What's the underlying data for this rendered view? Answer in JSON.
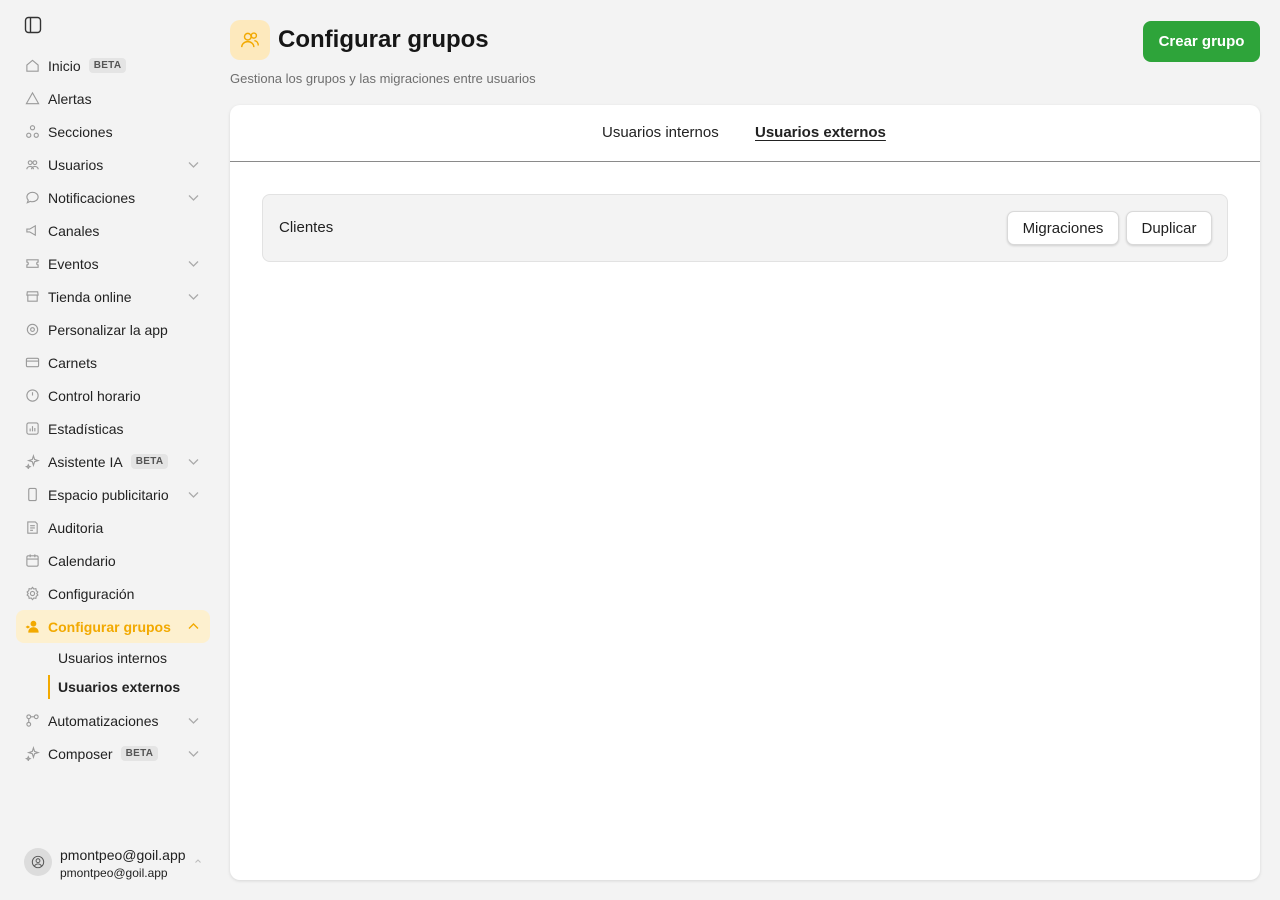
{
  "sidebar": {
    "items": [
      {
        "label": "Inicio",
        "badge": "BETA",
        "icon": "home-icon",
        "expandable": false
      },
      {
        "label": "Alertas",
        "badge": "",
        "icon": "alert-icon",
        "expandable": false
      },
      {
        "label": "Secciones",
        "badge": "",
        "icon": "sections-icon",
        "expandable": false
      },
      {
        "label": "Usuarios",
        "badge": "",
        "icon": "users-icon",
        "expandable": true
      },
      {
        "label": "Notificaciones",
        "badge": "",
        "icon": "chat-icon",
        "expandable": true
      },
      {
        "label": "Canales",
        "badge": "",
        "icon": "megaphone-icon",
        "expandable": false
      },
      {
        "label": "Eventos",
        "badge": "",
        "icon": "ticket-icon",
        "expandable": true
      },
      {
        "label": "Tienda online",
        "badge": "",
        "icon": "store-icon",
        "expandable": true
      },
      {
        "label": "Personalizar la app",
        "badge": "",
        "icon": "palette-icon",
        "expandable": false
      },
      {
        "label": "Carnets",
        "badge": "",
        "icon": "card-icon",
        "expandable": false
      },
      {
        "label": "Control horario",
        "badge": "",
        "icon": "clock-icon",
        "expandable": false
      },
      {
        "label": "Estadísticas",
        "badge": "",
        "icon": "stats-icon",
        "expandable": false
      },
      {
        "label": "Asistente IA",
        "badge": "BETA",
        "icon": "sparkle-icon",
        "expandable": true
      },
      {
        "label": "Espacio publicitario",
        "badge": "",
        "icon": "phone-icon",
        "expandable": true
      },
      {
        "label": "Auditoria",
        "badge": "",
        "icon": "audit-icon",
        "expandable": false
      },
      {
        "label": "Calendario",
        "badge": "",
        "icon": "calendar-icon",
        "expandable": false
      },
      {
        "label": "Configuración",
        "badge": "",
        "icon": "gear-icon",
        "expandable": false
      }
    ],
    "active": {
      "label": "Configurar grupos",
      "icon": "group-config-icon"
    },
    "subitems": [
      "Usuarios internos",
      "Usuarios externos"
    ],
    "after": [
      {
        "label": "Automatizaciones",
        "badge": "",
        "icon": "automation-icon",
        "expandable": true
      },
      {
        "label": "Composer",
        "badge": "BETA",
        "icon": "sparkle-icon",
        "expandable": true
      }
    ],
    "user": {
      "name": "pmontpeo@goil.app",
      "email": "pmontpeo@goil.app"
    }
  },
  "header": {
    "title": "Configurar grupos",
    "subtitle": "Gestiona los grupos y las migraciones entre usuarios",
    "create_label": "Crear grupo"
  },
  "tabs": [
    "Usuarios internos",
    "Usuarios externos"
  ],
  "selected_tab": "Usuarios externos",
  "groups": [
    {
      "name": "Clientes",
      "migrate_label": "Migraciones",
      "duplicate_label": "Duplicar"
    }
  ],
  "colors": {
    "accent": "#f2a900",
    "primary_button": "#2ea43a",
    "active_bg": "#fdf0cf"
  }
}
